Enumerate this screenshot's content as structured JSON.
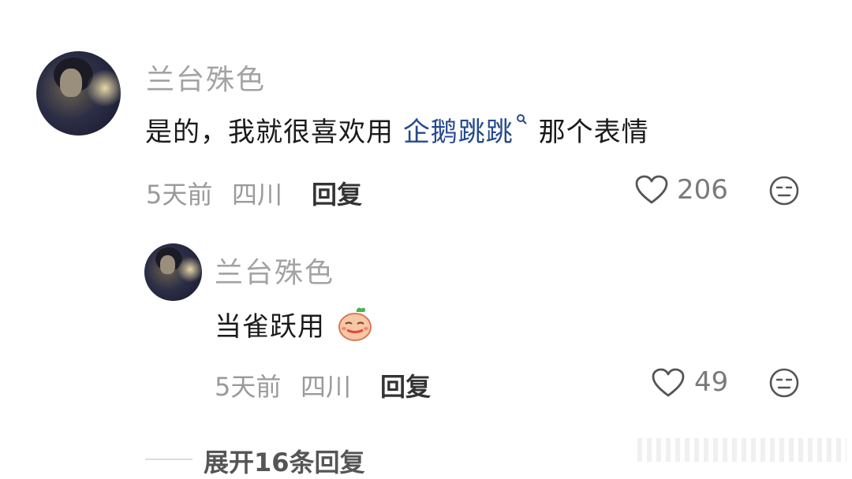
{
  "comment": {
    "username": "兰台殊色",
    "text_before": "是的，我就很喜欢用 ",
    "link_text": "企鹅跳跳",
    "text_after": " 那个表情",
    "time": "5天前",
    "location": "四川",
    "reply_label": "回复",
    "likes": "206"
  },
  "reply": {
    "username": "兰台殊色",
    "text": "当雀跃用",
    "emoji": "radish-face-emoji",
    "time": "5天前",
    "location": "四川",
    "reply_label": "回复",
    "likes": "49"
  },
  "expand_label": "展开16条回复",
  "colors": {
    "link": "#254a8f",
    "meta": "#9a9a9a",
    "name": "#a3a3a3"
  }
}
